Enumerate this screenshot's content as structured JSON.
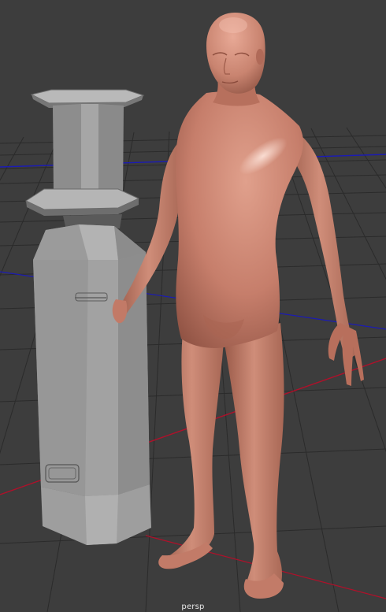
{
  "viewport": {
    "camera_name": "persp",
    "background_color": "#3d3d3d",
    "grid_color": "#2c2c2c",
    "x_axis_color": "#b0102a",
    "z_axis_color": "#1b1bb5"
  },
  "scene_objects": [
    {
      "name": "pedestal-object",
      "material_color": "#9a9a9a"
    },
    {
      "name": "human-figure-object",
      "material_color": "#c67e6b"
    }
  ]
}
